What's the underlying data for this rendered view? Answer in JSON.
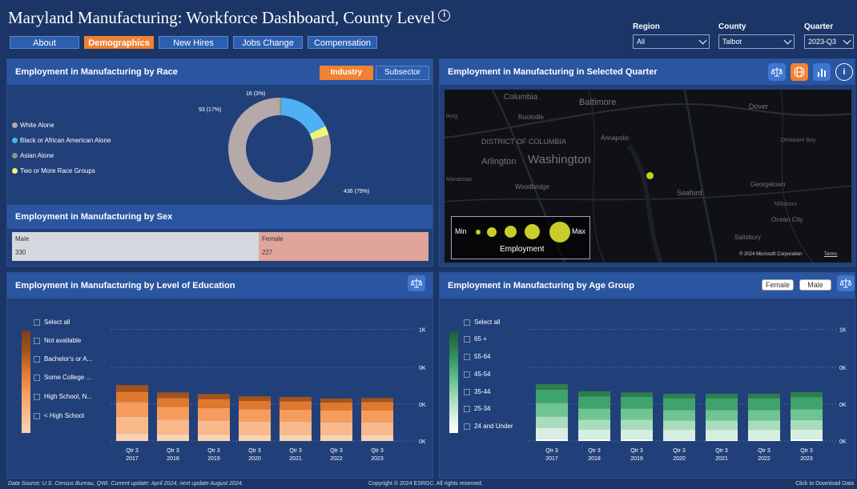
{
  "header": {
    "title": "Maryland Manufacturing: Workforce Dashboard, County Level",
    "info_icon": "i"
  },
  "tabs": [
    {
      "label": "About"
    },
    {
      "label": "Demographics"
    },
    {
      "label": "New Hires"
    },
    {
      "label": "Jobs Change"
    },
    {
      "label": "Compensation"
    }
  ],
  "filters": {
    "region": {
      "label": "Region",
      "value": "All"
    },
    "county": {
      "label": "County",
      "value": "Talbot"
    },
    "quarter": {
      "label": "Quarter",
      "value": "2023-Q3"
    }
  },
  "race": {
    "title": "Employment in Manufacturing by Race",
    "industry_label": "Industry",
    "subsector_label": "Subsector",
    "legend": [
      "White Alone",
      "Black or African American Alone",
      "Asian Alone",
      "Two or More Race Groups"
    ],
    "colors": [
      "#b5a9a9",
      "#4fb0f5",
      "#8a978a",
      "#f0f57a"
    ],
    "labels": [
      "16 (3%)",
      "93 (17%)",
      "436 (79%)"
    ]
  },
  "sex": {
    "title": "Employment in Manufacturing by Sex",
    "male_label": "Male",
    "male_value": "330",
    "female_label": "Female",
    "female_value": "227"
  },
  "map": {
    "title": "Employment in Manufacturing in Selected Quarter",
    "places": [
      "Columbia",
      "Baltimore",
      "Rockville",
      "DISTRICT OF COLUMBIA",
      "Annapolis",
      "Arlington",
      "Washington",
      "Woodbridge",
      "Dover",
      "Delaware Bay",
      "Seaford",
      "Georgetown",
      "Salisbury",
      "Ocean City",
      "Millsboro",
      "Manassas",
      "burg"
    ],
    "legend_min": "Min",
    "legend_max": "Max",
    "legend_caption": "Employment",
    "copyright": "© 2024 Microsoft Corporation",
    "terms": "Terms"
  },
  "education": {
    "title": "Employment in Manufacturing by Level of Education",
    "legend": [
      "Select all",
      "Not available",
      "Bachelor's or A...",
      "Some College ...",
      "High School, N...",
      "< High School"
    ]
  },
  "age": {
    "title": "Employment in Manufacturing by Age Group",
    "female_btn": "Female",
    "male_btn": "Male",
    "legend": [
      "Select all",
      "65 +",
      "55-64",
      "45-54",
      "35-44",
      "25-34",
      "24 and Under"
    ]
  },
  "axis": {
    "q_labels": [
      "Qtr 3",
      "Qtr 3",
      "Qtr 3",
      "Qtr 3",
      "Qtr 3",
      "Qtr 3",
      "Qtr 3"
    ],
    "years": [
      "2017",
      "2018",
      "2019",
      "2020",
      "2021",
      "2022",
      "2023"
    ],
    "edu_y": [
      "1K",
      "0K",
      "0K",
      "0K"
    ],
    "age_y": [
      "1K",
      "0K",
      "0K",
      "0K"
    ]
  },
  "footer": {
    "source": "Data Source: U.S. Census Bureau, QWI. Current update: April 2024, next update August 2024.",
    "copyright": "Copyright © 2024 ESRGC. All rights reserved.",
    "download": "Click to Download Data"
  },
  "chart_data": [
    {
      "type": "pie",
      "title": "Employment in Manufacturing by Race",
      "categories": [
        "White Alone",
        "Black or African American Alone",
        "Asian Alone",
        "Two or More Race Groups"
      ],
      "values": [
        436,
        93,
        4,
        16
      ]
    },
    {
      "type": "bar",
      "title": "Employment in Manufacturing by Sex",
      "categories": [
        "Male",
        "Female"
      ],
      "values": [
        330,
        227
      ]
    },
    {
      "type": "bar",
      "title": "Employment in Manufacturing by Level of Education",
      "categories": [
        "Qtr 3 2017",
        "Qtr 3 2018",
        "Qtr 3 2019",
        "Qtr 3 2020",
        "Qtr 3 2021",
        "Qtr 3 2022",
        "Qtr 3 2023"
      ],
      "series": [
        {
          "name": "< High School",
          "values": [
            70,
            60,
            60,
            55,
            55,
            55,
            55
          ]
        },
        {
          "name": "High School, N...",
          "values": [
            150,
            130,
            125,
            120,
            120,
            115,
            115
          ]
        },
        {
          "name": "Some College ...",
          "values": [
            130,
            115,
            110,
            110,
            105,
            105,
            105
          ]
        },
        {
          "name": "Bachelor's or A...",
          "values": [
            90,
            80,
            80,
            75,
            75,
            70,
            75
          ]
        },
        {
          "name": "Not available",
          "values": [
            60,
            50,
            45,
            40,
            40,
            35,
            35
          ]
        }
      ],
      "colors": [
        "#fbd2b2",
        "#f9b98a",
        "#f59c5e",
        "#e0782e",
        "#a4531c",
        "#7a3e16"
      ],
      "ylim": [
        0,
        1000
      ]
    },
    {
      "type": "bar",
      "title": "Employment in Manufacturing by Age Group",
      "categories": [
        "Qtr 3 2017",
        "Qtr 3 2018",
        "Qtr 3 2019",
        "Qtr 3 2020",
        "Qtr 3 2021",
        "Qtr 3 2022",
        "Qtr 3 2023"
      ],
      "series": [
        {
          "name": "24 and Under",
          "values": [
            20,
            15,
            15,
            12,
            12,
            12,
            15
          ]
        },
        {
          "name": "25-34",
          "values": [
            100,
            90,
            90,
            88,
            88,
            88,
            90
          ]
        },
        {
          "name": "35-44",
          "values": [
            100,
            85,
            85,
            83,
            83,
            83,
            83
          ]
        },
        {
          "name": "45-54",
          "values": [
            120,
            100,
            100,
            95,
            95,
            95,
            95
          ]
        },
        {
          "name": "55-64",
          "values": [
            120,
            110,
            105,
            105,
            105,
            105,
            110
          ]
        },
        {
          "name": "65 +",
          "values": [
            50,
            45,
            40,
            40,
            40,
            40,
            45
          ]
        }
      ],
      "colors": [
        "#ffffff",
        "#d7efe0",
        "#a8dcbb",
        "#6fc493",
        "#3fa36c",
        "#2e7d4f",
        "#1f5d3a"
      ],
      "ylim": [
        0,
        1000
      ]
    }
  ]
}
